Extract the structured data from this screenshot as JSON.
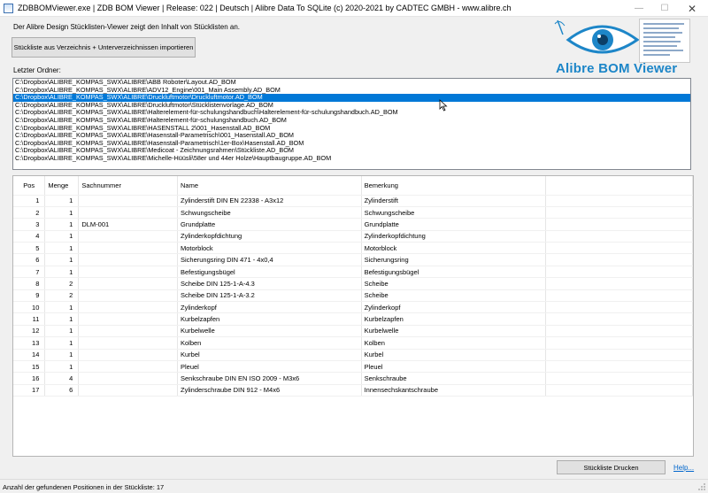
{
  "window": {
    "title": "ZDBBOMViewer.exe | ZDB BOM Viewer | Release: 022 | Deutsch | Alibre Data To SQLite (c) 2020-2021 by CADTEC GMBH - www.alibre.ch",
    "min_glyph": "—",
    "max_glyph": "☐",
    "close_glyph": "✕"
  },
  "intro_text": "Der Alibre Design Stücklisten-Viewer zeigt den Inhalt von Stücklisten an.",
  "import_button": "Stückliste aus Verzeichnis + Unterverzeichnissen importieren",
  "logo": {
    "text": "Alibre BOM Viewer",
    "accent": "#1d86c8"
  },
  "folder_label": "Letzter Ordner:",
  "folders": [
    "C:\\Dropbox\\ALIBRE_KOMPAS_SWX\\ALIBRE\\ABB Roboter\\Layout.AD_BOM",
    "C:\\Dropbox\\ALIBRE_KOMPAS_SWX\\ALIBRE\\ADV12_Engine\\001_Main Assembly.AD_BOM",
    "C:\\Dropbox\\ALIBRE_KOMPAS_SWX\\ALIBRE\\Druckluftmotor\\Druckluftmotor.AD_BOM",
    "C:\\Dropbox\\ALIBRE_KOMPAS_SWX\\ALIBRE\\Druckluftmotor\\Stücklistenvorlage.AD_BOM",
    "C:\\Dropbox\\ALIBRE_KOMPAS_SWX\\ALIBRE\\Halterelement-für-schulungshandbuch\\Halterelement-für-schulungshandbuch.AD_BOM",
    "C:\\Dropbox\\ALIBRE_KOMPAS_SWX\\ALIBRE\\Halterelement-für-schulungshandbuch.AD_BOM",
    "C:\\Dropbox\\ALIBRE_KOMPAS_SWX\\ALIBRE\\HASENSTALL 2\\001_Hasenstall.AD_BOM",
    "C:\\Dropbox\\ALIBRE_KOMPAS_SWX\\ALIBRE\\Hasenstall-Parametrisch\\001_Hasenstall.AD_BOM",
    "C:\\Dropbox\\ALIBRE_KOMPAS_SWX\\ALIBRE\\Hasenstall-Parametrisch\\1er-Box\\Hasenstall.AD_BOM",
    "C:\\Dropbox\\ALIBRE_KOMPAS_SWX\\ALIBRE\\Medicoat - Zeichnungsrahmen\\Stückliste.AD_BOM",
    "C:\\Dropbox\\ALIBRE_KOMPAS_SWX\\ALIBRE\\Michelle-Hüüsli\\58er und 44er Holze\\Hauptbaugruppe.AD_BOM"
  ],
  "selected_folder_index": 2,
  "table": {
    "headers": [
      "Pos",
      "Menge",
      "Sachnummer",
      "Name",
      "Bemerkung"
    ],
    "rows": [
      [
        "1",
        "1",
        "",
        "Zylinderstift DIN EN 22338 - A3x12",
        "Zylinderstift"
      ],
      [
        "2",
        "1",
        "",
        "Schwungscheibe",
        "Schwungscheibe"
      ],
      [
        "3",
        "1",
        "DLM-001",
        "Grundplatte",
        "Grundplatte"
      ],
      [
        "4",
        "1",
        "",
        "Zylinderkopfdichtung",
        "Zylinderkopfdichtung"
      ],
      [
        "5",
        "1",
        "",
        "Motorblock",
        "Motorblock"
      ],
      [
        "6",
        "1",
        "",
        "Sicherungsring DIN 471 - 4x0,4",
        "Sicherungsring"
      ],
      [
        "7",
        "1",
        "",
        "Befestigungsbügel",
        "Befestigungsbügel"
      ],
      [
        "8",
        "2",
        "",
        "Scheibe DIN 125-1-A-4.3",
        "Scheibe"
      ],
      [
        "9",
        "2",
        "",
        "Scheibe DIN 125-1-A-3.2",
        "Scheibe"
      ],
      [
        "10",
        "1",
        "",
        "Zylinderkopf",
        "Zylinderkopf"
      ],
      [
        "11",
        "1",
        "",
        "Kurbelzapfen",
        "Kurbelzapfen"
      ],
      [
        "12",
        "1",
        "",
        "Kurbelwelle",
        "Kurbelwelle"
      ],
      [
        "13",
        "1",
        "",
        "Kolben",
        "Kolben"
      ],
      [
        "14",
        "1",
        "",
        "Kurbel",
        "Kurbel"
      ],
      [
        "15",
        "1",
        "",
        "Pleuel",
        "Pleuel"
      ],
      [
        "16",
        "4",
        "",
        "Senkschraube DIN EN ISO 2009 - M3x6",
        "Senkschraube"
      ],
      [
        "17",
        "6",
        "",
        "Zylinderschraube DIN 912 - M4x6",
        "Innensechskantschraube"
      ]
    ]
  },
  "print_button": "Stückliste Drucken",
  "help_link": "Help...",
  "status_text": "Anzahl der gefundenen Positionen in der Stückliste: 17"
}
